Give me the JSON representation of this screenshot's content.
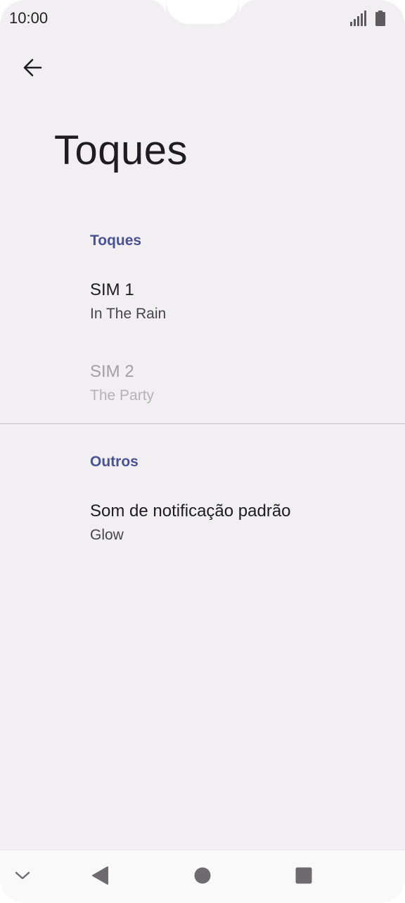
{
  "status_bar": {
    "time": "10:00",
    "icons": [
      "signal-icon",
      "battery-icon"
    ]
  },
  "header": {
    "back_icon": "arrow-back-icon",
    "title": "Toques"
  },
  "sections": [
    {
      "header": "Toques",
      "items": [
        {
          "title": "SIM 1",
          "summary": "In The Rain",
          "enabled": true
        },
        {
          "title": "SIM 2",
          "summary": "The Party",
          "enabled": false
        }
      ]
    },
    {
      "header": "Outros",
      "items": [
        {
          "title": "Som de notificação padrão",
          "summary": "Glow",
          "enabled": true
        }
      ]
    }
  ],
  "nav_bar": {
    "buttons": [
      "chevron-down-icon",
      "back-triangle-icon",
      "home-circle-icon",
      "recents-square-icon"
    ]
  },
  "colors": {
    "background": "#f1eff2",
    "accent": "#4a5391",
    "text_primary": "#1e1c20",
    "text_disabled": "#a19fa3"
  }
}
